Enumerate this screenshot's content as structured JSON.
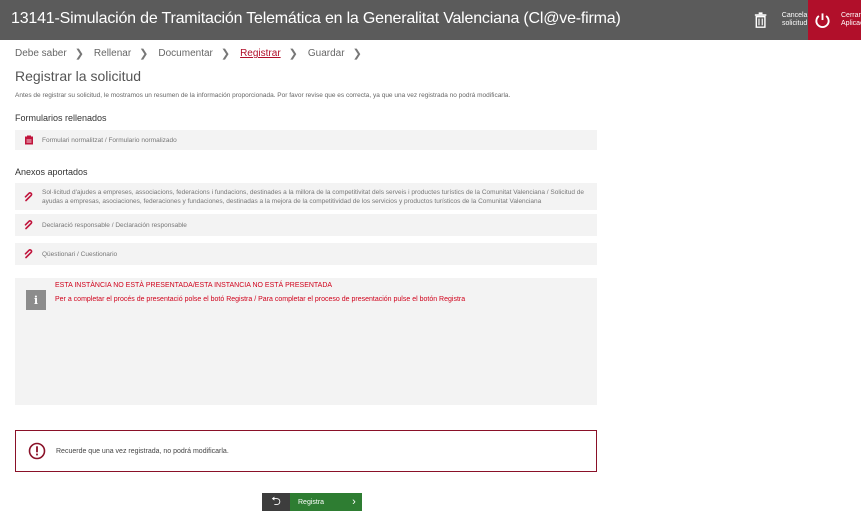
{
  "header": {
    "title": "13141-Simulación de Tramitación Telemática en la Generalitat Valenciana (Cl@ve-firma)",
    "cancel_label_line1": "Cancela",
    "cancel_label_line2": "solicitud",
    "exit_label_line1": "Cerrar",
    "exit_label_line2": "Aplicación",
    "exit_bg": "#b10f2a",
    "bg": "#5b5b5b"
  },
  "steps": [
    {
      "label": "Debe saber"
    },
    {
      "label": "Rellenar"
    },
    {
      "label": "Documentar"
    },
    {
      "label": "Registrar"
    },
    {
      "label": "Guardar"
    }
  ],
  "active_step": "Registrar",
  "page": {
    "title": "Registrar la solicitud",
    "intro": "Antes de registrar su solicitud, le mostramos un resumen de la información proporcionada. Por favor revise que es correcta, ya que una vez registrada no podrá modificarla."
  },
  "forms_section": {
    "title": "Formularios rellenados",
    "items": [
      {
        "label": "Formulari normalitzat / Formulario normalizado",
        "icon": "form-icon"
      }
    ]
  },
  "annexes_section": {
    "title": "Anexos aportados",
    "items": [
      {
        "label": "Sol·licitud d'ajudes a empreses, associacions, federacions i fundacions, destinades a la millora de la competitivitat dels serveis i productes turístics de la Comunitat Valenciana / Solicitud de ayudas a empresas, asociaciones, federaciones y fundaciones, destinadas a la mejora de la competitividad de los servicios y productos turísticos de la Comunitat Valenciana",
        "icon": "paperclip-icon"
      },
      {
        "label": "Declaració responsable / Declaración responsable",
        "icon": "paperclip-icon"
      },
      {
        "label": "Qüestionari / Cuestionario",
        "icon": "paperclip-icon"
      }
    ]
  },
  "info": {
    "line1": "ESTA INSTÀNCIA NO ESTÀ PRESENTADA/ESTA INSTANCIA NO ESTÁ PRESENTADA",
    "line2": "Per a completar el procés de presentació polse el botó Registra / Para completar el proceso de presentación pulse el botón Registra",
    "icon_glyph": "i",
    "color": "#d0021b"
  },
  "warning": {
    "text": "Recuerde que una vez registrada, no podrá modificarla.",
    "border_color": "#8a1128"
  },
  "submit": {
    "label": "Registra",
    "back_glyph": "⮌",
    "next_glyph": "›",
    "color": "#2e7d32"
  }
}
